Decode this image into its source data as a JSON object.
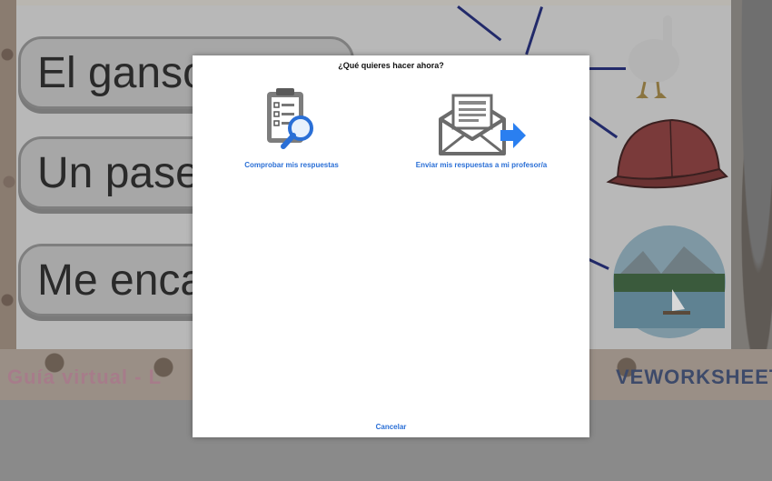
{
  "worksheet": {
    "phrases": [
      "El ganso",
      "Un paseo",
      "Me encan"
    ],
    "footer_left": "Guía virtual - L",
    "footer_right": "VEWORKSHEETS"
  },
  "dialog": {
    "title": "¿Qué quieres hacer ahora?",
    "options": [
      {
        "label": "Comprobar mis respuestas",
        "icon": "clipboard-magnifier-icon"
      },
      {
        "label": "Enviar mis respuestas a mi profesor/a",
        "icon": "envelope-send-icon"
      }
    ],
    "cancel_label": "Cancelar"
  },
  "colors": {
    "accent": "#2a6fd6",
    "overlay": "#8a8a8a"
  }
}
